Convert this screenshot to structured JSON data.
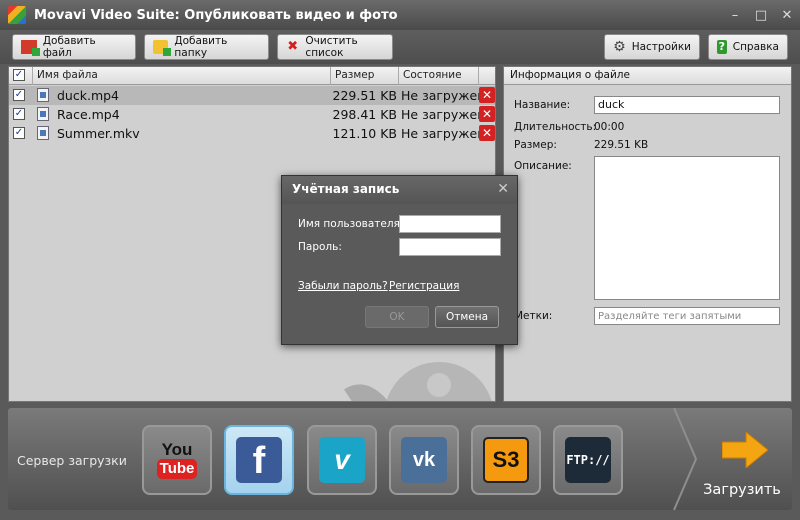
{
  "window": {
    "title": "Movavi Video Suite: Опубликовать видео и фото",
    "controls": [
      "–",
      "□",
      "✕"
    ]
  },
  "toolbar": {
    "add_file": "Добавить файл",
    "add_folder": "Добавить папку",
    "clear_list": "Очистить список",
    "settings": "Настройки",
    "help": "Справка"
  },
  "filelist": {
    "headers": {
      "name": "Имя файла",
      "size": "Размер",
      "state": "Состояние"
    },
    "rows": [
      {
        "name": "duck.mp4",
        "size": "229.51 KB",
        "state": "Не загружен",
        "checked": true,
        "selected": true
      },
      {
        "name": "Race.mp4",
        "size": "298.41 KB",
        "state": "Не загружен",
        "checked": true,
        "selected": false
      },
      {
        "name": "Summer.mkv",
        "size": "121.10 KB",
        "state": "Не загружен",
        "checked": true,
        "selected": false
      }
    ]
  },
  "info": {
    "header": "Информация о файле",
    "name_label": "Название:",
    "name_value": "duck",
    "duration_label": "Длительность:",
    "duration_value": "00:00",
    "size_label": "Размер:",
    "size_value": "229.51 KB",
    "description_label": "Описание:",
    "tags_label": "Метки:",
    "tags_placeholder": "Разделяйте теги запятыми"
  },
  "dialog": {
    "title": "Учётная запись",
    "username_label": "Имя пользователя:",
    "password_label": "Пароль:",
    "forgot_link": "Забыли пароль?",
    "register_link": "Регистрация",
    "ok": "OK",
    "cancel": "Отмена"
  },
  "upload": {
    "server_label": "Сервер загрузки",
    "services": [
      "YouTube",
      "Facebook",
      "Vimeo",
      "VK",
      "S3",
      "FTP"
    ],
    "active_service": "Facebook",
    "upload_label": "Загрузить"
  },
  "icons": {
    "youtube_you": "You",
    "youtube_tube": "Tube",
    "facebook": "f",
    "vimeo": "v",
    "vk": "vk",
    "s3": "S3",
    "ftp": "FTP://"
  }
}
